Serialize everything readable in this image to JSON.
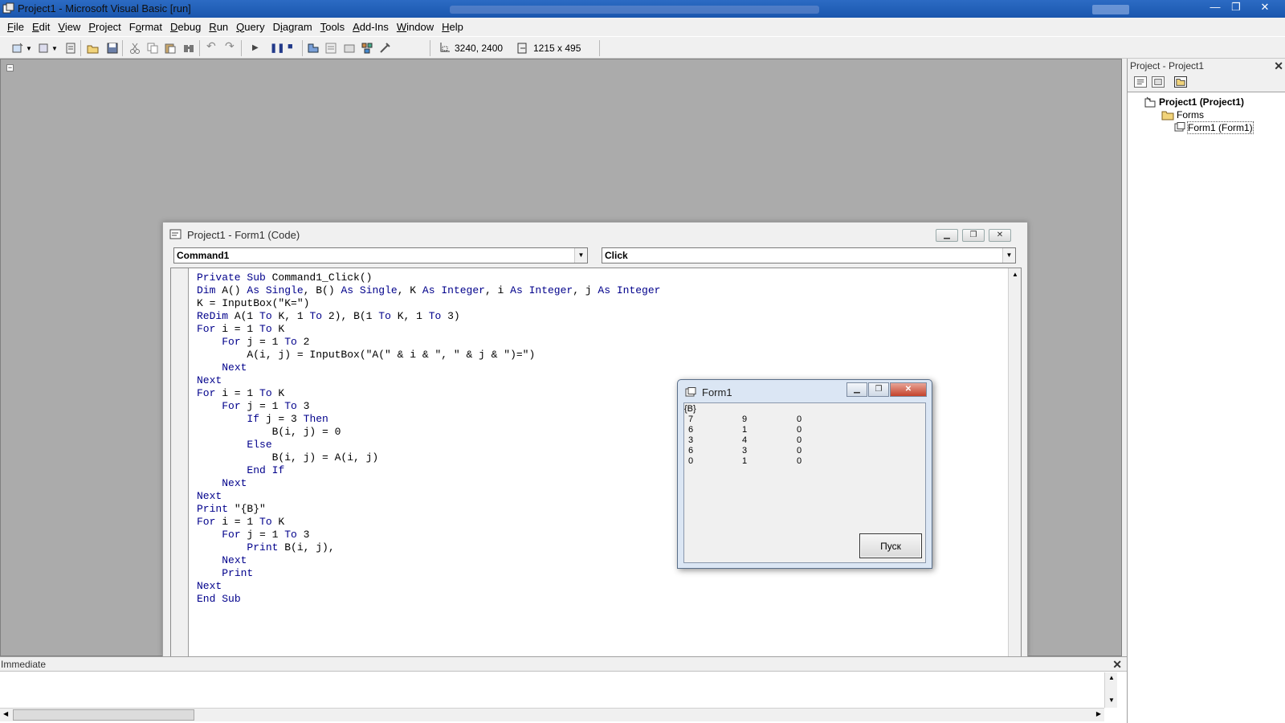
{
  "app": {
    "title": "Project1 - Microsoft Visual Basic [run]",
    "window_controls": {
      "minimize": "—",
      "restore": "❐",
      "close": "✕"
    }
  },
  "menu": [
    {
      "key": "F",
      "rest": "ile"
    },
    {
      "key": "E",
      "rest": "dit"
    },
    {
      "key": "V",
      "rest": "iew"
    },
    {
      "key": "P",
      "rest": "roject"
    },
    {
      "key": "o",
      "pre": "F",
      "rest": "rmat"
    },
    {
      "key": "D",
      "rest": "ebug"
    },
    {
      "key": "R",
      "rest": "un"
    },
    {
      "key": "Q",
      "rest": "uery"
    },
    {
      "key": "i",
      "pre": "D",
      "rest": "agram"
    },
    {
      "key": "T",
      "rest": "ools"
    },
    {
      "key": "A",
      "rest": "dd-Ins"
    },
    {
      "key": "W",
      "rest": "indow"
    },
    {
      "key": "H",
      "rest": "elp"
    }
  ],
  "toolbar": {
    "position": "3240, 2400",
    "size": "1215 x 495"
  },
  "code_window": {
    "title": "Project1 - Form1 (Code)",
    "object_combo": "Command1",
    "procedure_combo": "Click",
    "lines": [
      "Private Sub Command1_Click()",
      "Dim A() As Single, B() As Single, K As Integer, i As Integer, j As Integer",
      "K = InputBox(\"K=\")",
      "ReDim A(1 To K, 1 To 2), B(1 To K, 1 To 3)",
      "For i = 1 To K",
      "    For j = 1 To 2",
      "        A(i, j) = InputBox(\"A(\" & i & \", \" & j & \")=\")",
      "    Next",
      "Next",
      "For i = 1 To K",
      "    For j = 1 To 3",
      "        If j = 3 Then",
      "            B(i, j) = 0",
      "        Else",
      "            B(i, j) = A(i, j)",
      "        End If",
      "    Next",
      "Next",
      "Print \"{B}\"",
      "For i = 1 To K",
      "    For j = 1 To 3",
      "        Print B(i, j),",
      "    Next",
      "    Print",
      "Next",
      "End Sub"
    ]
  },
  "form1": {
    "title": "Form1",
    "header": "{B}",
    "rows": [
      [
        "7",
        "9",
        "0"
      ],
      [
        "6",
        "1",
        "0"
      ],
      [
        "3",
        "4",
        "0"
      ],
      [
        "6",
        "3",
        "0"
      ],
      [
        "0",
        "1",
        "0"
      ]
    ],
    "button_label": "Пуск"
  },
  "project_explorer": {
    "title": "Project - Project1",
    "root": "Project1 (Project1)",
    "folder": "Forms",
    "item": "Form1 (Form1)"
  },
  "immediate": {
    "title": "Immediate"
  }
}
